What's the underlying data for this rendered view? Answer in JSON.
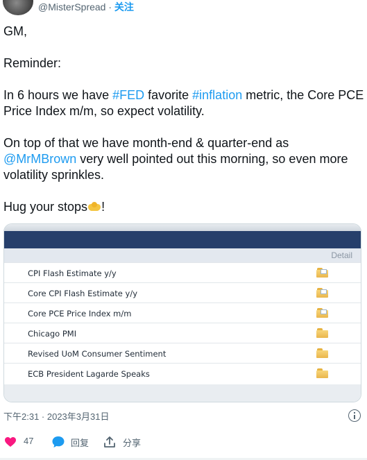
{
  "author": {
    "handle": "@MisterSpread",
    "separator": "·",
    "follow_label": "关注"
  },
  "tweet": {
    "line_greeting": "GM,",
    "line_reminder": "Reminder:",
    "p1_a": "In 6 hours we have ",
    "p1_tag_fed": "#FED",
    "p1_b": " favorite ",
    "p1_tag_inflation": "#inflation",
    "p1_c": " metric, the  Core PCE Price Index m/m, so expect volatility.",
    "p2_a": "On top of that we have month-end & quarter-end as ",
    "p2_mention": "@MrMBrown",
    "p2_b": " very well pointed out this morning, so even more volatility sprinkles.",
    "p3_a": "Hug your stops",
    "p3_b": "!"
  },
  "card": {
    "detail_header": "Detail",
    "events": [
      {
        "name": "CPI Flash Estimate y/y",
        "icon": "folder-doc-icon"
      },
      {
        "name": "Core CPI Flash Estimate y/y",
        "icon": "folder-doc-icon"
      },
      {
        "name": "Core PCE Price Index m/m",
        "icon": "folder-doc-icon"
      },
      {
        "name": "Chicago PMI",
        "icon": "folder-icon"
      },
      {
        "name": "Revised UoM Consumer Sentiment",
        "icon": "folder-icon"
      },
      {
        "name": "ECB President Lagarde Speaks",
        "icon": "folder-icon"
      }
    ]
  },
  "meta": {
    "timestamp": "下午2:31 · 2023年3月31日"
  },
  "actions": {
    "likes_count": "47",
    "reply_label": "回复",
    "share_label": "分享"
  },
  "colors": {
    "link": "#1d9bf0",
    "like": "#f91880",
    "card_header": "#263f6b"
  }
}
